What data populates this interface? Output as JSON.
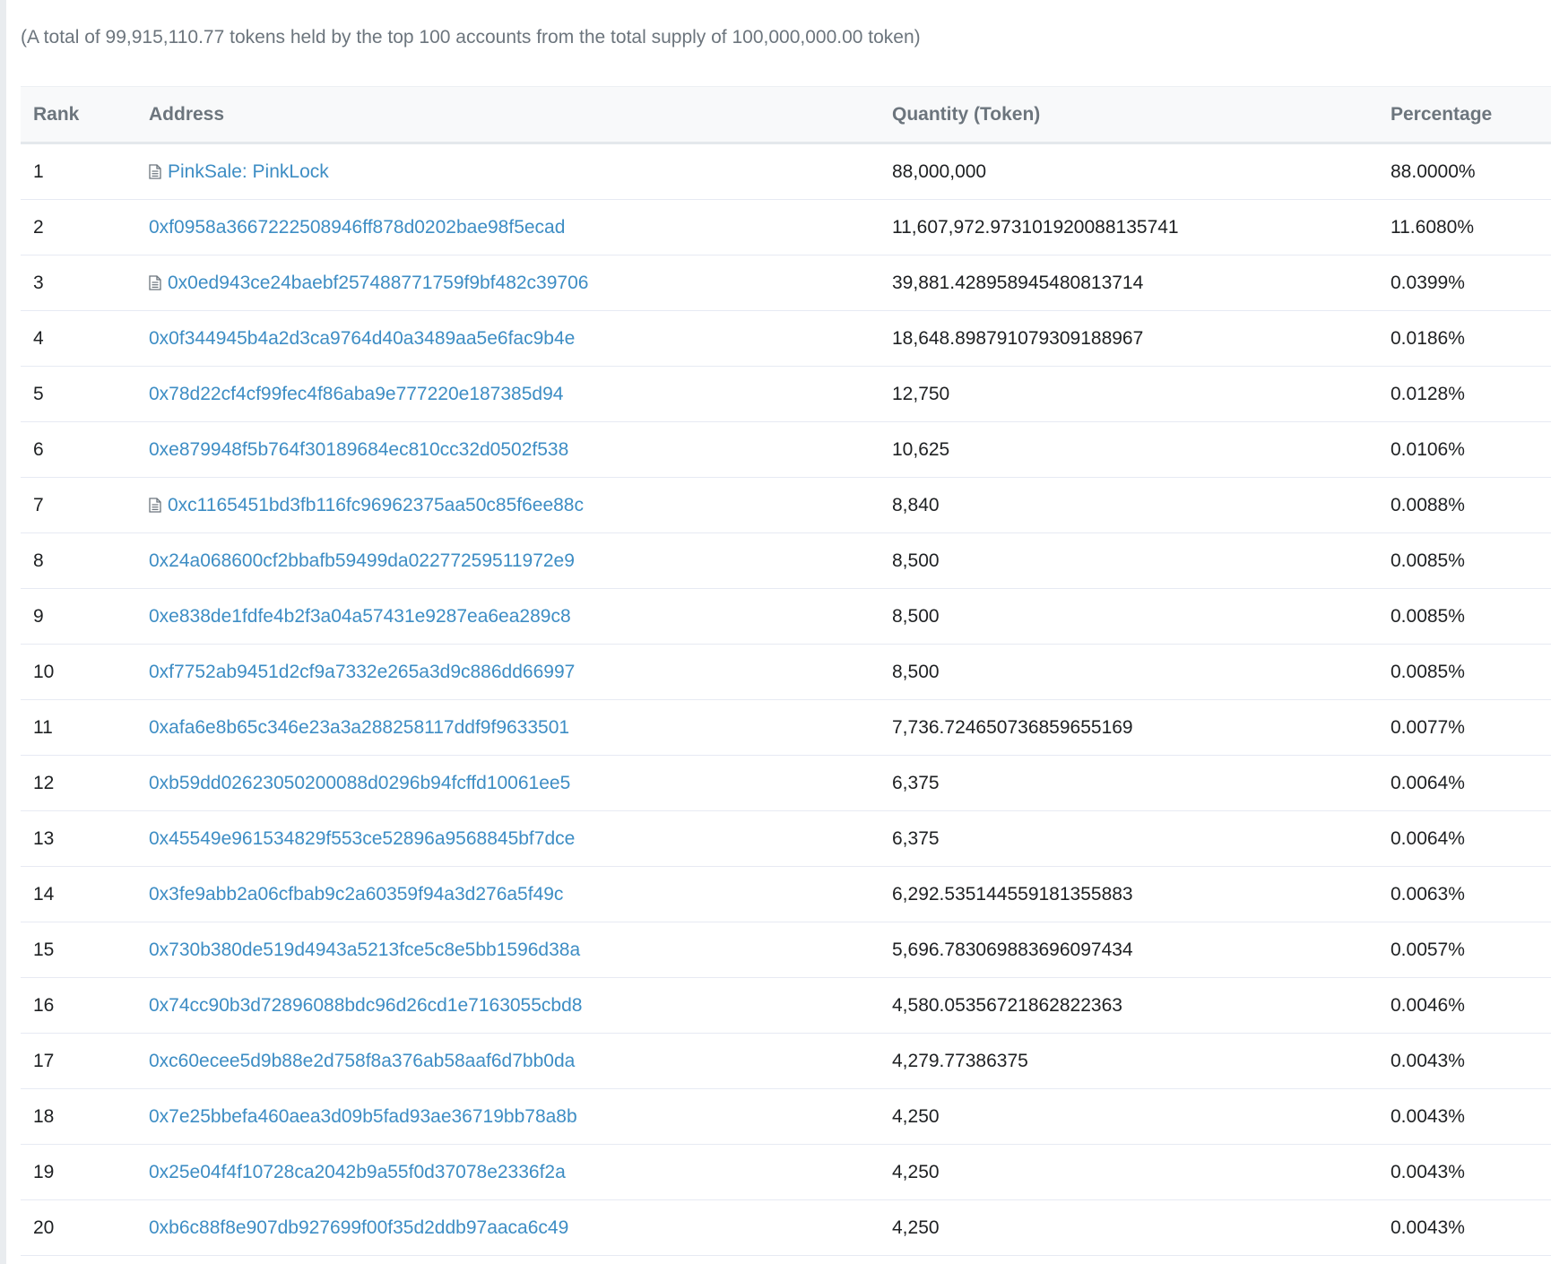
{
  "summary_text": "(A total of 99,915,110.77 tokens held by the top 100 accounts from the total supply of 100,000,000.00 token)",
  "table": {
    "headers": {
      "rank": "Rank",
      "address": "Address",
      "quantity": "Quantity (Token)",
      "percentage": "Percentage"
    },
    "rows": [
      {
        "rank": "1",
        "address": "PinkSale: PinkLock",
        "is_contract": true,
        "quantity": "88,000,000",
        "percentage": "88.0000%"
      },
      {
        "rank": "2",
        "address": "0xf0958a3667222508946ff878d0202bae98f5ecad",
        "is_contract": false,
        "quantity": "11,607,972.97310192008813574​1",
        "percentage": "11.6080%"
      },
      {
        "rank": "3",
        "address": "0x0ed943ce24baebf257488771759f9bf482c39706",
        "is_contract": true,
        "quantity": "39,881.428958945480813714",
        "percentage": "0.0399%"
      },
      {
        "rank": "4",
        "address": "0x0f344945b4a2d3ca9764d40a3489aa5e6fac9b4e",
        "is_contract": false,
        "quantity": "18,648.898791079309188967",
        "percentage": "0.0186%"
      },
      {
        "rank": "5",
        "address": "0x78d22cf4cf99fec4f86aba9e777220e187385d94",
        "is_contract": false,
        "quantity": "12,750",
        "percentage": "0.0128%"
      },
      {
        "rank": "6",
        "address": "0xe879948f5b764f30189684ec810cc32d0502f538",
        "is_contract": false,
        "quantity": "10,625",
        "percentage": "0.0106%"
      },
      {
        "rank": "7",
        "address": "0xc1165451bd3fb116fc96962375aa50c85f6ee88c",
        "is_contract": true,
        "quantity": "8,840",
        "percentage": "0.0088%"
      },
      {
        "rank": "8",
        "address": "0x24a068600cf2bbafb59499da02277259511972e9",
        "is_contract": false,
        "quantity": "8,500",
        "percentage": "0.0085%"
      },
      {
        "rank": "9",
        "address": "0xe838de1fdfe4b2f3a04a57431e9287ea6ea289c8",
        "is_contract": false,
        "quantity": "8,500",
        "percentage": "0.0085%"
      },
      {
        "rank": "10",
        "address": "0xf7752ab9451d2cf9a7332e265a3d9c886dd66997",
        "is_contract": false,
        "quantity": "8,500",
        "percentage": "0.0085%"
      },
      {
        "rank": "11",
        "address": "0xafa6e8b65c346e23a3a288258117ddf9f9633501",
        "is_contract": false,
        "quantity": "7,736.724650736859655169",
        "percentage": "0.0077%"
      },
      {
        "rank": "12",
        "address": "0xb59dd02623050200088d0296b94fcffd10061ee5",
        "is_contract": false,
        "quantity": "6,375",
        "percentage": "0.0064%"
      },
      {
        "rank": "13",
        "address": "0x45549e961534829f553ce52896a9568845bf7dce",
        "is_contract": false,
        "quantity": "6,375",
        "percentage": "0.0064%"
      },
      {
        "rank": "14",
        "address": "0x3fe9abb2a06cfbab9c2a60359f94a3d276a5f49c",
        "is_contract": false,
        "quantity": "6,292.535144559181355883",
        "percentage": "0.0063%"
      },
      {
        "rank": "15",
        "address": "0x730b380de519d4943a5213fce5c8e5bb1596d38a",
        "is_contract": false,
        "quantity": "5,696.783069883696097434",
        "percentage": "0.0057%"
      },
      {
        "rank": "16",
        "address": "0x74cc90b3d72896088bdc96d26cd1e7163055cbd8",
        "is_contract": false,
        "quantity": "4,580.05356721862822363",
        "percentage": "0.0046%"
      },
      {
        "rank": "17",
        "address": "0xc60ecee5d9b88e2d758f8a376ab58aaf6d7bb0da",
        "is_contract": false,
        "quantity": "4,279.77386375",
        "percentage": "0.0043%"
      },
      {
        "rank": "18",
        "address": "0x7e25bbefa460aea3d09b5fad93ae36719bb78a8b",
        "is_contract": false,
        "quantity": "4,250",
        "percentage": "0.0043%"
      },
      {
        "rank": "19",
        "address": "0x25e04f4f10728ca2042b9a55f0d37078e2336f2a",
        "is_contract": false,
        "quantity": "4,250",
        "percentage": "0.0043%"
      },
      {
        "rank": "20",
        "address": "0xb6c88f8e907db927699f00f35d2ddb97aaca6c49",
        "is_contract": false,
        "quantity": "4,250",
        "percentage": "0.0043%"
      }
    ]
  },
  "icons": {
    "contract": "contract-document-icon"
  },
  "colors": {
    "link": "#3d8dc4",
    "text": "#1e2022",
    "muted": "#6c757d",
    "header_bg": "#f8f9fa",
    "row_border": "#e7eaf3"
  }
}
